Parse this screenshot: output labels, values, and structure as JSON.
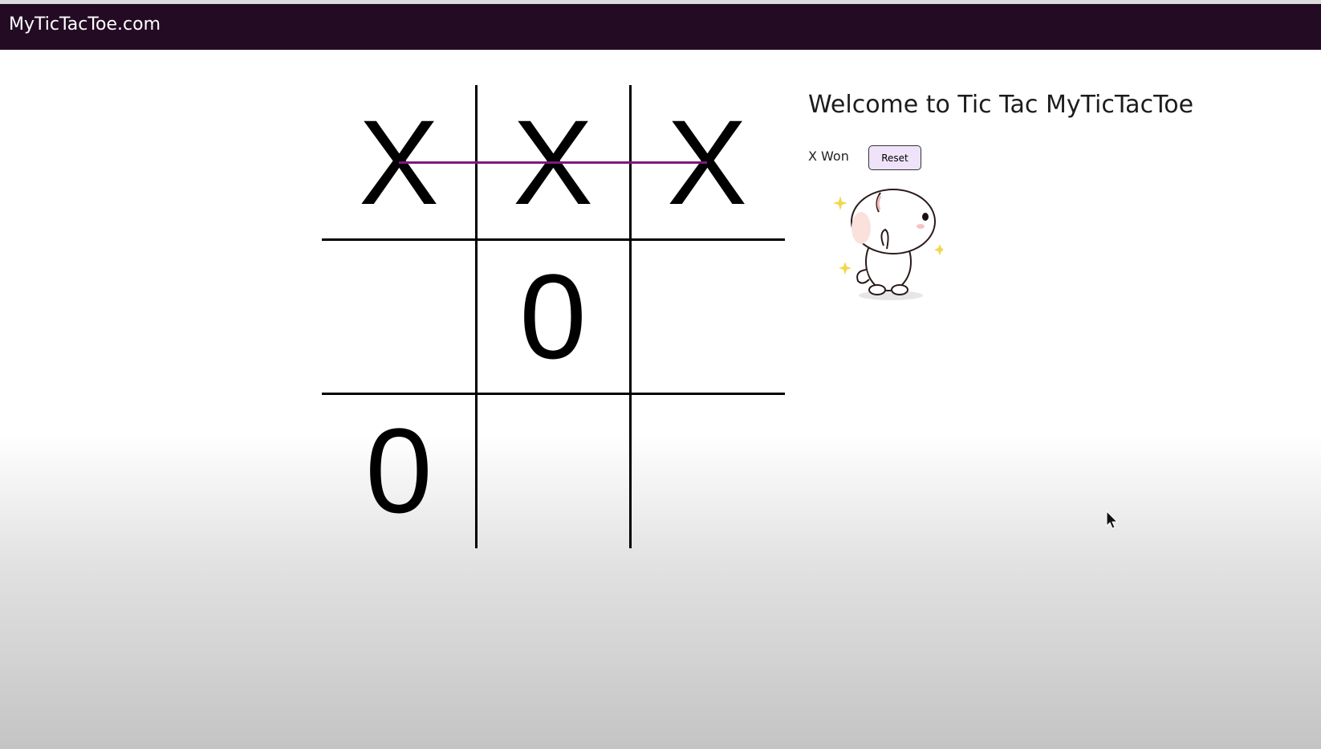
{
  "header": {
    "brand": "MyTicTacToe.com"
  },
  "board": {
    "cells": [
      "X",
      "X",
      "X",
      "",
      "0",
      "",
      "0",
      "",
      ""
    ],
    "winning_line": "top-row",
    "colors": {
      "lines": "#000000",
      "strike": "#7a1c7e"
    }
  },
  "side": {
    "title": "Welcome to Tic Tac MyTicTacToe",
    "status": "X Won",
    "reset_label": "Reset"
  },
  "sticker": {
    "icon": "cat-sticker-icon"
  },
  "theme": {
    "navbar": "#240b24",
    "button": "#efe3fa"
  }
}
